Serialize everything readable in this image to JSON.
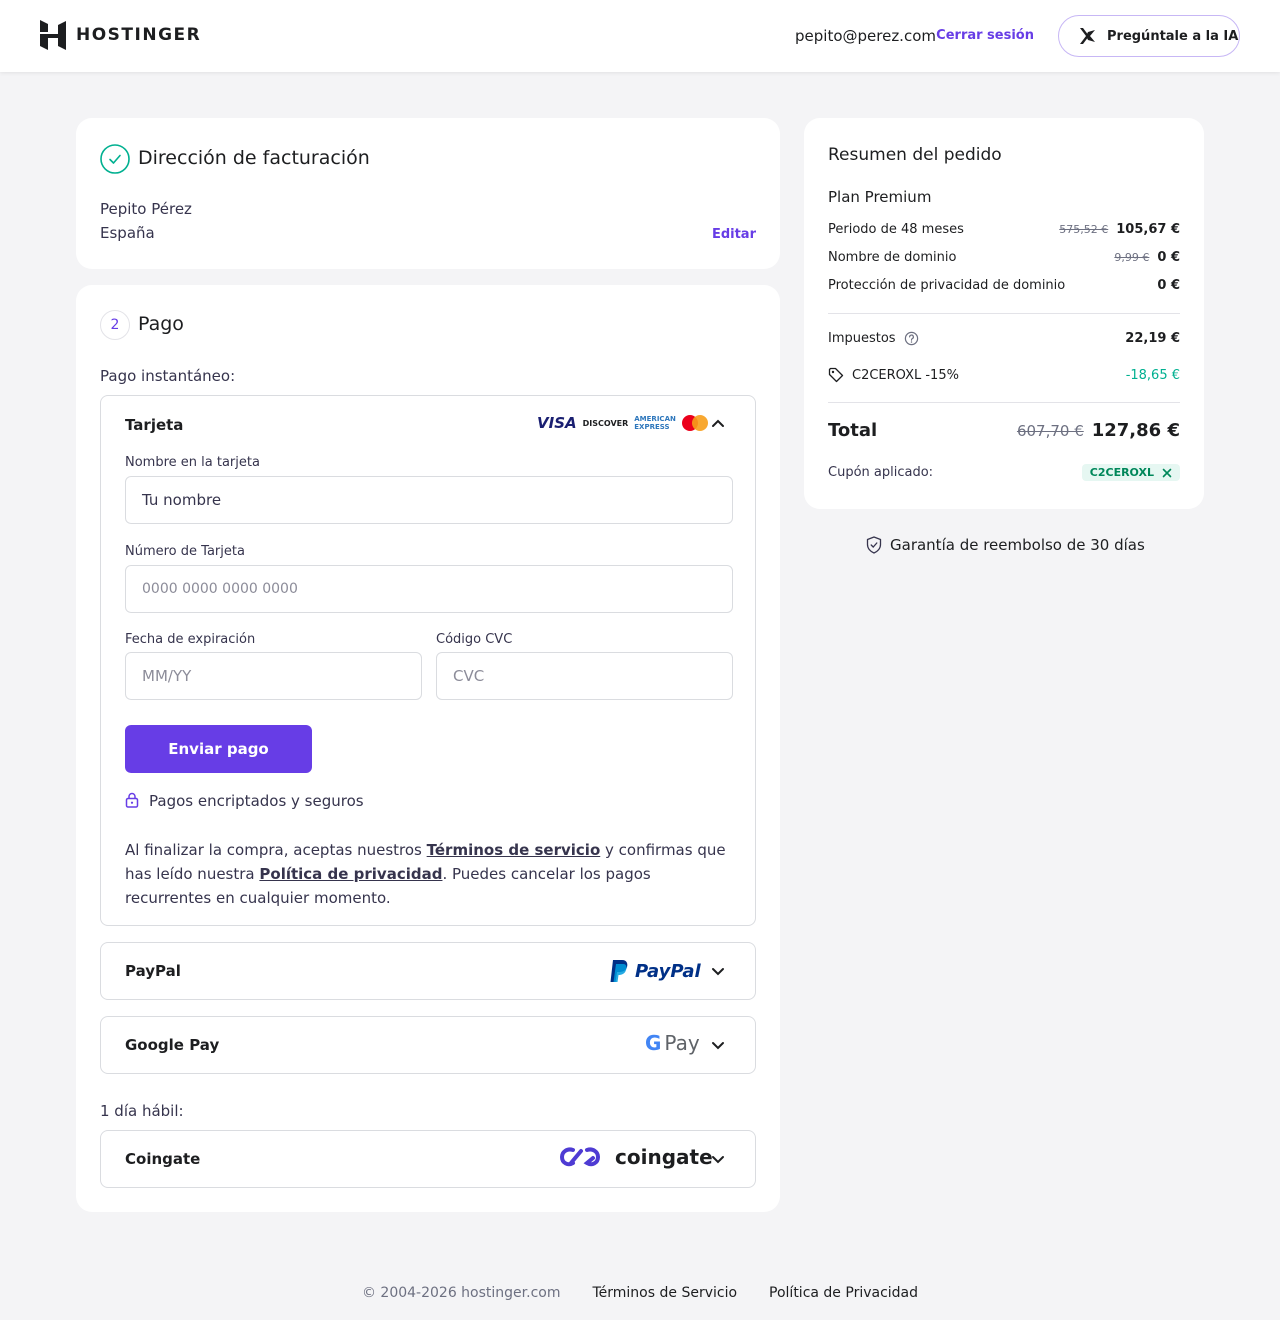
{
  "header": {
    "logo_text": "HOSTINGER",
    "email": "pepito@perez.com",
    "logout_label": "Cerrar sesión",
    "ask_ai_label": "Pregúntale a la IA"
  },
  "billing": {
    "title": "Dirección de facturación",
    "name": "Pepito Pérez",
    "country": "España",
    "edit_label": "Editar"
  },
  "payment": {
    "step_number": "2",
    "title": "Pago",
    "instant_label": "Pago instantáneo:",
    "card": {
      "label": "Tarjeta",
      "brands": {
        "visa": "VISA",
        "discover": "DISCOVER",
        "amex_line1": "AMERICAN",
        "amex_line2": "EXPRESS"
      },
      "name_label": "Nombre en la tarjeta",
      "name_value": "Tu nombre",
      "number_label": "Número de Tarjeta",
      "number_placeholder": "0000 0000 0000 0000",
      "expiry_label": "Fecha de expiración",
      "expiry_placeholder": "MM/YY",
      "cvc_label": "Código CVC",
      "cvc_placeholder": "CVC",
      "submit_label": "Enviar pago",
      "secure_label": "Pagos encriptados y seguros",
      "terms_1": "Al finalizar la compra, aceptas nuestros ",
      "terms_link_1": "Términos de servicio",
      "terms_2": " y confirmas que has leído nuestra ",
      "terms_link_2": "Política de privacidad",
      "terms_3": ". Puedes cancelar los pagos recurrentes en cualquier momento."
    },
    "paypal": {
      "label": "PayPal",
      "logo_text": "PayPal"
    },
    "gpay": {
      "label": "Google Pay",
      "logo_g": "G",
      "logo_text": "Pay"
    },
    "business_day_label": "1 día hábil:",
    "coingate": {
      "label": "Coingate",
      "logo_text": "coingate"
    }
  },
  "summary": {
    "title": "Resumen del pedido",
    "plan": "Plan Premium",
    "rows": [
      {
        "label": "Periodo de 48 meses",
        "old": "575,52 €",
        "value": "105,67 €"
      },
      {
        "label": "Nombre de dominio",
        "old": "9,99 €",
        "value": "0 €"
      },
      {
        "label": "Protección de privacidad de dominio",
        "old": "",
        "value": "0 €"
      }
    ],
    "taxes_label": "Impuestos",
    "taxes_value": "22,19 €",
    "coupon_line_label": "C2CEROXL -15%",
    "coupon_line_value": "-18,65 €",
    "total_label": "Total",
    "total_old": "607,70 €",
    "total_value": "127,86 €",
    "coupon_applied_label": "Cupón aplicado:",
    "coupon_code": "C2CEROXL",
    "guarantee": "Garantía de reembolso de 30 días"
  },
  "footer": {
    "copyright": "© 2004-2026 hostinger.com",
    "terms": "Términos de Servicio",
    "privacy": "Política de Privacidad"
  },
  "colors": {
    "accent": "#673de6",
    "success": "#00b090",
    "text": "#1d1e20"
  }
}
